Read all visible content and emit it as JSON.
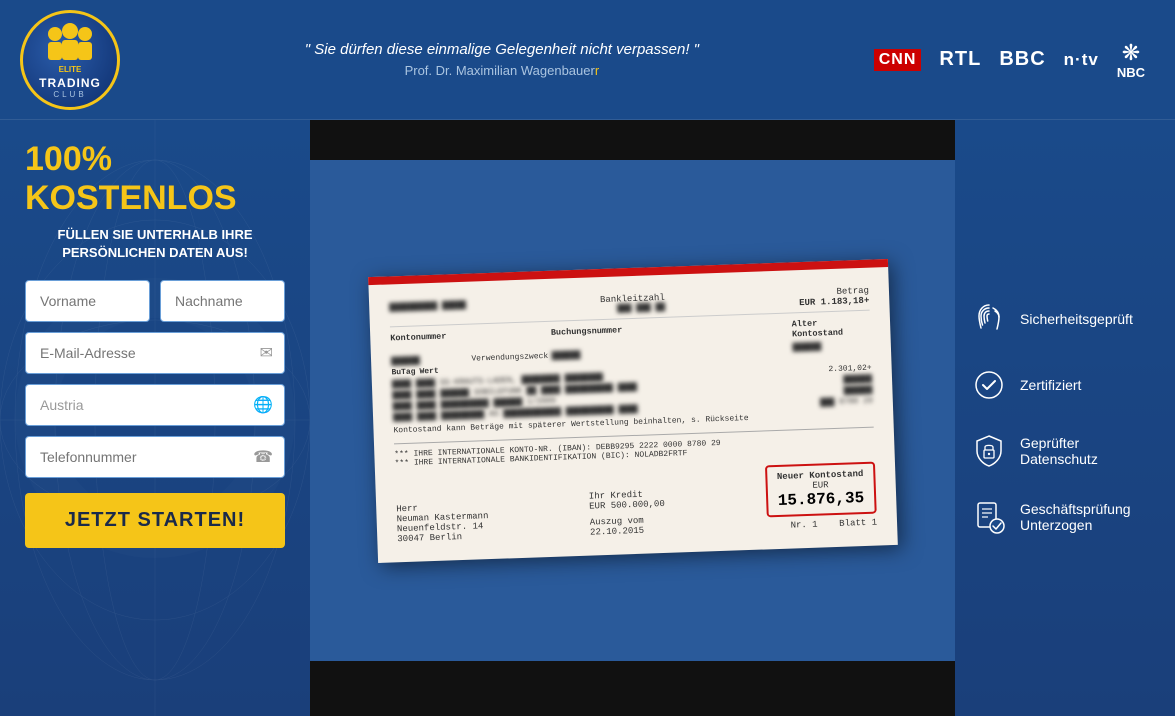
{
  "header": {
    "logo": {
      "line1": "ELITE",
      "line2": "TRADING",
      "line3": "CLUB"
    },
    "quote": "\" Sie dürfen diese einmalige Gelegenheit nicht verpassen! \"",
    "author": "Prof. Dr. Maximilian Wagenbauer",
    "author_highlight": "r",
    "media": [
      "CNN",
      "RTL",
      "BBC",
      "n·tv",
      "NBC"
    ]
  },
  "form": {
    "free_label": "100% KOSTENLOS",
    "fill_label": "FÜLLEN SIE UNTERHALB IHRE\nPERSÖNLICHEN DATEN AUS!",
    "firstname_placeholder": "Vorname",
    "lastname_placeholder": "Nachname",
    "email_placeholder": "E-Mail-Adresse",
    "country_value": "Austria",
    "phone_placeholder": "Telefonnummer",
    "submit_label": "JETZT STARTEN!"
  },
  "bank_statement": {
    "bankleitzahl_label": "Bankleitzahl",
    "betrag_label": "Betrag",
    "betrag_value": "EUR 1.183,18+",
    "buchungsnummer_label": "Buchungsnummer",
    "kontonummer_label": "Kontonummer",
    "verwendungszweck_label": "Verwendungszweck",
    "alter_kontostand_label": "Alter Kontostand",
    "butag_label": "BuTag",
    "wert_label": "Wert",
    "iban_line1": "*** IHRE INTERNATIONALE KONTO-NR. (IBAN): DEBB9295 2222 0000 8780 29",
    "iban_line2": "*** IHRE INTERNATIONALE BANKIDENTIFIKATION (BIC): NOLADB2FRTF",
    "note": "Kontostand kann Beträge mit späterer Wertstellung beinhalten, s. Rückseite",
    "footer_name": "Herr",
    "footer_person": "Neuman Kastermann",
    "footer_address1": "Neuenfeldstr. 14",
    "footer_address2": "30047 Berlin",
    "kredit_label": "Ihr   Kredit",
    "kredit_value": "EUR   500.000,00",
    "auszug_label": "Auszug vom",
    "auszug_date": "22.10.2015",
    "nr_label": "Nr.",
    "nr_value": "1",
    "new_balance_header": "Neuer Kontostand",
    "new_balance_value": "15.876,35",
    "eur_label": "EUR",
    "blatt_label": "Blatt",
    "blatt_value": "1"
  },
  "trust_items": [
    {
      "icon": "fingerprint",
      "label": "Sicherheitsgeprüft"
    },
    {
      "icon": "check-shield",
      "label": "Zertifiziert"
    },
    {
      "icon": "lock-shield",
      "label": "Geprüfter Datenschutz"
    },
    {
      "icon": "document-check",
      "label": "Geschäftsprüfung Unterzogen"
    }
  ]
}
